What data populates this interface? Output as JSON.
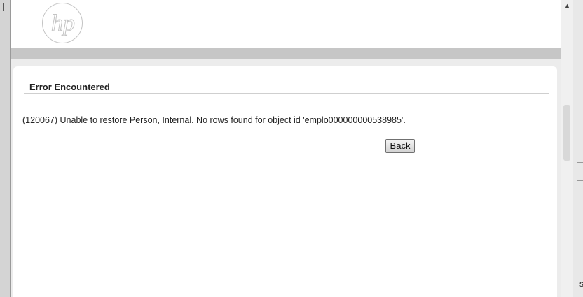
{
  "header": {
    "logo_text": "hp"
  },
  "panel": {
    "title": "Error Encountered",
    "message": "(120067) Unable to restore Person, Internal. No rows found for object id 'emplo000000000538985'.",
    "back_label": "Back"
  },
  "background": {
    "right_edge_text": "s"
  },
  "icons": {
    "logo": "hp-logo",
    "scroll_up": "scroll-up-arrow-icon"
  }
}
